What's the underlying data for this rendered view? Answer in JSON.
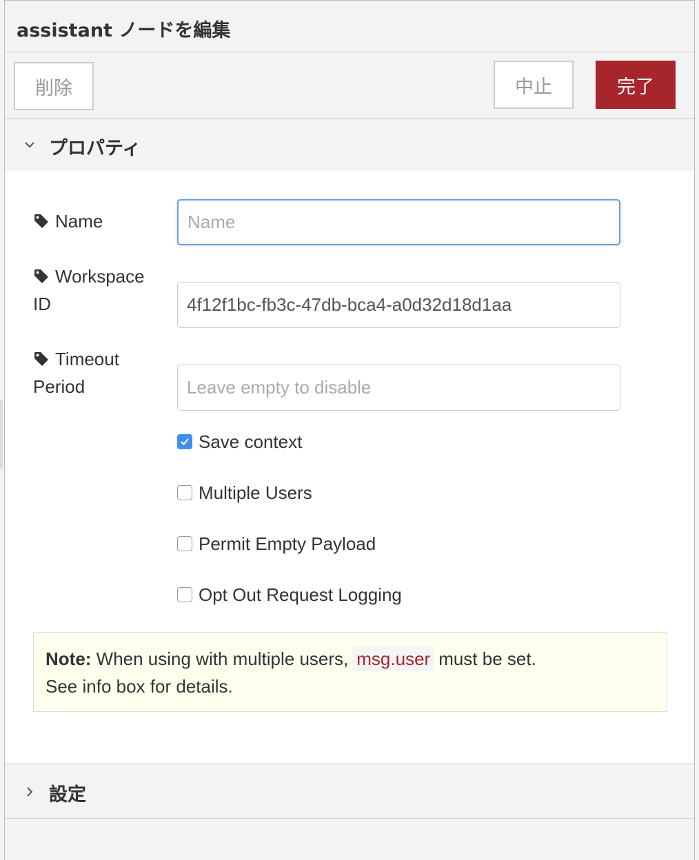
{
  "header": {
    "title": "assistant ノードを編集"
  },
  "toolbar": {
    "delete_label": "削除",
    "cancel_label": "中止",
    "done_label": "完了"
  },
  "sections": {
    "properties": "プロパティ",
    "settings": "設定"
  },
  "form": {
    "name": {
      "label": "Name",
      "placeholder": "Name",
      "value": ""
    },
    "workspace": {
      "label_line1": "Workspace",
      "label_line2": "ID",
      "value": "4f12f1bc-fb3c-47db-bca4-a0d32d18d1aa"
    },
    "timeout": {
      "label_line1": "Timeout",
      "label_line2": "Period",
      "placeholder": "Leave empty to disable",
      "value": ""
    },
    "checkboxes": [
      {
        "label": "Save context",
        "checked": true
      },
      {
        "label": "Multiple Users",
        "checked": false
      },
      {
        "label": "Permit Empty Payload",
        "checked": false
      },
      {
        "label": "Opt Out Request Logging",
        "checked": false
      }
    ]
  },
  "note": {
    "bold": "Note:",
    "text_before": " When using with multiple users,",
    "code": "msg.user",
    "text_after": "must be set.",
    "line2": "See info box for details."
  },
  "icons": {
    "tag": "tag-icon",
    "expanded": "chevron-down-icon",
    "collapsed": "chevron-right-icon",
    "check": "checkmark-icon"
  },
  "colors": {
    "primary_button": "#a6262c",
    "checkbox_checked": "#3f8fef",
    "focus_border": "#6a9fe0",
    "note_background": "#ffffee",
    "code_text": "#a6262c"
  }
}
